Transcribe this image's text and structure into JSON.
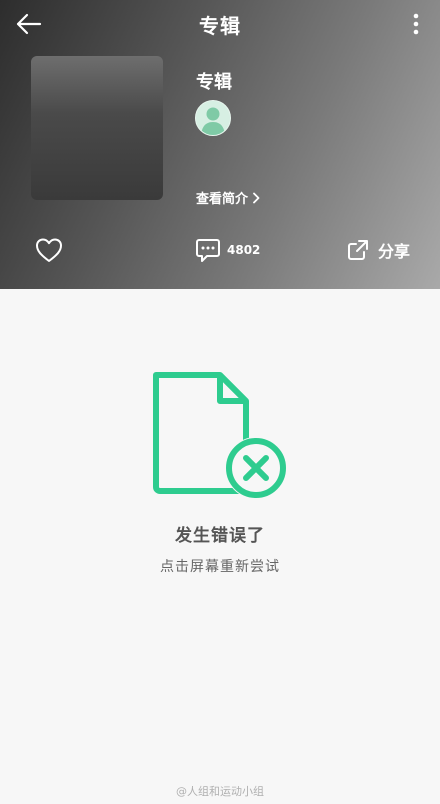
{
  "header": {
    "title": "专辑",
    "album_name": "专辑",
    "intro_link": "查看简介",
    "comment_count": "4802",
    "share_label": "分享"
  },
  "error": {
    "title": "发生错误了",
    "hint": "点击屏幕重新尝试"
  },
  "watermark": "@人组和运动小组",
  "icons": {
    "back": "arrow-left-icon",
    "more": "more-vertical-icon",
    "like": "heart-icon",
    "comment": "comment-icon",
    "share": "share-icon",
    "error": "file-error-icon",
    "chevron": "chevron-right-icon",
    "avatar": "user-avatar-icon"
  },
  "colors": {
    "accent": "#2ecc8f",
    "header_dark": "#2d2d2d",
    "header_light": "#a9a9a9",
    "background": "#f7f7f7",
    "error_text": "#555555"
  }
}
